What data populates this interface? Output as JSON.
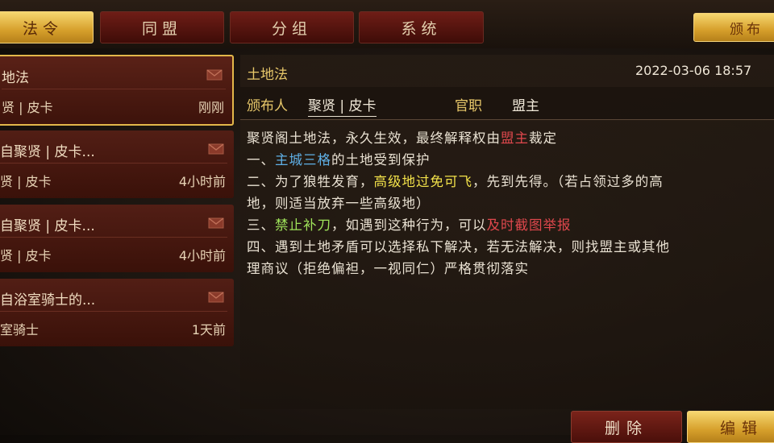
{
  "tabs": [
    {
      "label": "法令",
      "active": true
    },
    {
      "label": "同盟",
      "active": false
    },
    {
      "label": "分组",
      "active": false
    },
    {
      "label": "系统",
      "active": false
    }
  ],
  "publish_label": "颁布",
  "messages": [
    {
      "title": "地法",
      "sender": "贤 | 皮卡",
      "time": "刚刚"
    },
    {
      "title": "自聚贤 | 皮卡...",
      "sender": "贤 | 皮卡",
      "time": "4小时前"
    },
    {
      "title": "自聚贤 | 皮卡...",
      "sender": "贤 | 皮卡",
      "time": "4小时前"
    },
    {
      "title": "自浴室骑士的...",
      "sender": "室骑士",
      "time": "1天前"
    }
  ],
  "detail": {
    "title": "土地法",
    "date": "2022-03-06 18:57",
    "publisher_label": "颁布人",
    "publisher": "聚贤 | 皮卡",
    "rank_label": "官职",
    "rank": "盟主",
    "body": {
      "l1a": "聚贤阁土地法，永久生效，最终解释权由",
      "l1b": "盟主",
      "l1c": "裁定",
      "l2a": "一、",
      "l2b": "主城三格",
      "l2c": "的土地受到保护",
      "l3a": "二、为了狼牲发育，",
      "l3b": "高级地过免可飞",
      "l3c": "，先到先得。（若占领过多的高",
      "l4": "地，则适当放弃一些高级地）",
      "l5a": "三、",
      "l5b": "禁止补刀",
      "l5c": "，如遇到这种行为，可以",
      "l5d": "及时截图举报",
      "l6": "四、遇到土地矛盾可以选择私下解决，若无法解决，则找盟主或其他",
      "l7": "理商议（拒绝偏袒，一视同仁）严格贯彻落实"
    }
  },
  "buttons": {
    "delete": "删除",
    "edit": "编辑"
  },
  "colors": {
    "accent_gold": "#e8c86a",
    "tab_red": "#6e1d16",
    "highlight_blue": "#5fb0e6",
    "highlight_yellow": "#f3e24a",
    "highlight_green": "#9fe35a",
    "highlight_red": "#e0484d"
  }
}
